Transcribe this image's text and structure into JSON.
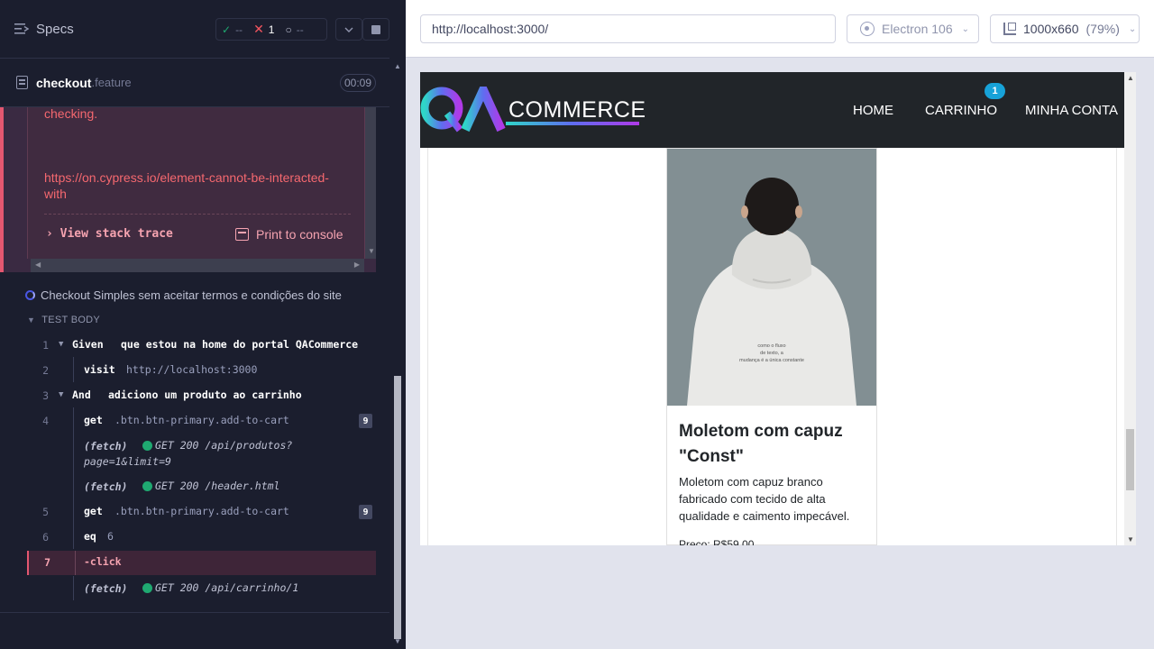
{
  "runner": {
    "header": {
      "specs_label": "Specs",
      "stats": {
        "passed": "--",
        "failed": "1",
        "pending": "--"
      }
    },
    "spec": {
      "name": "checkout",
      "ext": ".feature",
      "time": "00:09"
    },
    "error": {
      "text_tail": "checking.",
      "doc_link": "https://on.cypress.io/element-cannot-be-interacted-with",
      "stack_trace_label": "View stack trace",
      "print_label": "Print to console"
    },
    "test": {
      "title": "Checkout Simples sem aceitar termos e condições do site",
      "body_header": "TEST BODY"
    },
    "commands": [
      {
        "num": "1",
        "name": "Given",
        "msg": "que estou na home do portal QACommerce"
      },
      {
        "num": "2",
        "name": "visit",
        "msg": "http://localhost:3000"
      },
      {
        "num": "3",
        "name": "And",
        "msg": "adiciono um produto ao carrinho"
      },
      {
        "num": "4",
        "name": "get",
        "msg": ".btn.btn-primary.add-to-cart",
        "badge": "9"
      },
      {
        "fetch": "(fetch)",
        "req_line1": "GET 200 /api/produtos?",
        "req_line2": "page=1&limit=9"
      },
      {
        "fetch": "(fetch)",
        "req_line1": "GET 200 /header.html"
      },
      {
        "num": "5",
        "name": "get",
        "msg": ".btn.btn-primary.add-to-cart",
        "badge": "9"
      },
      {
        "num": "6",
        "name": "eq",
        "msg": "6"
      },
      {
        "num": "7",
        "name": "-click"
      },
      {
        "fetch": "(fetch)",
        "req_line1": "GET 200 /api/carrinho/1"
      }
    ]
  },
  "aut": {
    "url": "http://localhost:3000/",
    "browser": "Electron 106",
    "viewport": "1000x660",
    "zoom": "(79%)",
    "site": {
      "logo_text": "COMMERCE",
      "nav": {
        "home": "HOME",
        "cart": "CARRINHO",
        "account": "MINHA CONTA",
        "cart_count": "1"
      },
      "product": {
        "title": "Moletom com capuz \"Const\"",
        "description": "Moletom com capuz branco fabricado com tecido de alta qualidade e caimento impecável.",
        "price": "Preço: R$59,00",
        "print_line1": "como o fluxo",
        "print_line2": "de texto, a",
        "print_line3": "mudança é a única constante"
      }
    }
  },
  "colors": {
    "runner_bg": "#1b1e2e",
    "error_red": "#f5686f",
    "pass_green": "#1fa971",
    "accent_blue": "#17a2d8",
    "nav_bg": "#212529"
  },
  "icons": [
    "specs-list-icon",
    "check-icon",
    "x-icon",
    "pending-icon",
    "chevron-down-icon",
    "stop-icon",
    "spec-file-icon",
    "print-icon",
    "electron-icon",
    "viewport-icon",
    "running-spinner-icon"
  ]
}
